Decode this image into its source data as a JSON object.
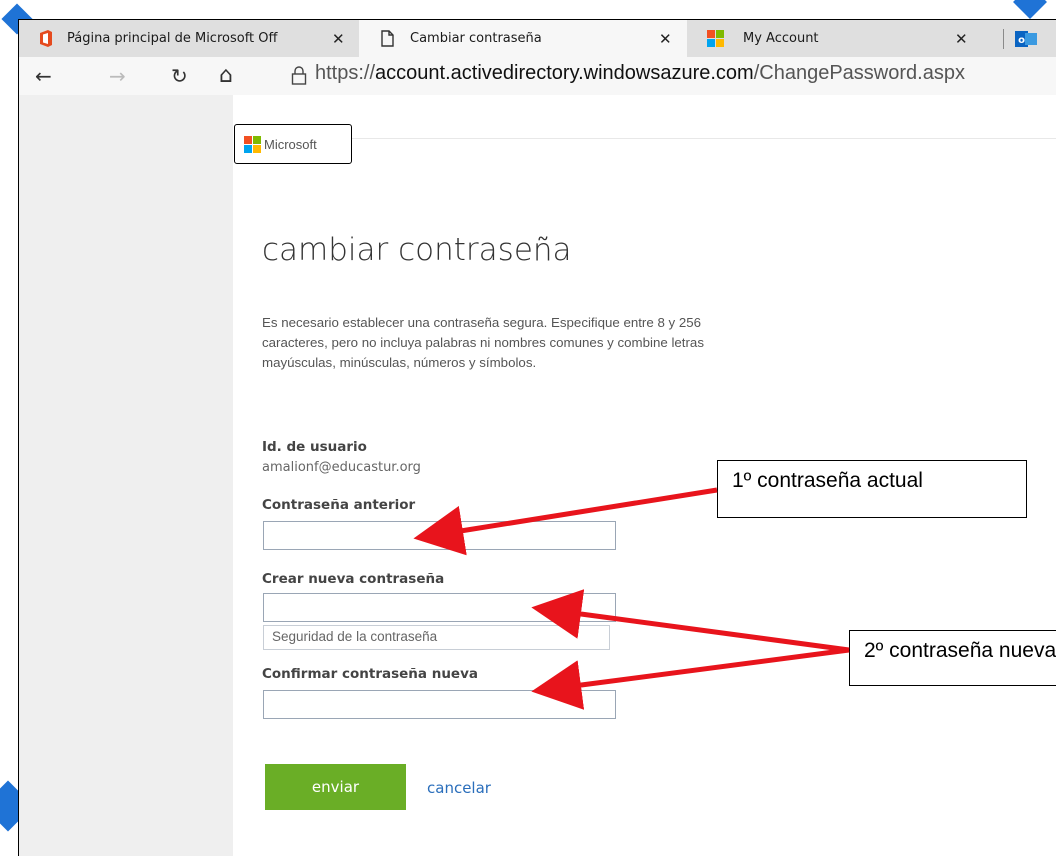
{
  "tabs": [
    {
      "label": "Página principal de Microsoft Off",
      "icon": "office-icon",
      "close": "✕"
    },
    {
      "label": "Cambiar contraseña",
      "icon": "page-icon",
      "close": "✕"
    },
    {
      "label": "My Account",
      "icon": "microsoft-logo-icon",
      "close": "✕"
    }
  ],
  "toolbar": {
    "back": "←",
    "forward": "→",
    "refresh": "↻",
    "home": "⌂",
    "lock": "🔒",
    "url_prefix": "https://",
    "url_domain": "account.activedirectory.windowsazure.com",
    "url_path": "/ChangePassword.aspx"
  },
  "header": {
    "logo_text": "Microsoft"
  },
  "form": {
    "title": "cambiar contraseña",
    "description": "Es necesario establecer una contraseña segura. Especifique entre 8 y 256 caracteres, pero no incluya palabras ni nombres comunes y combine letras mayúsculas, minúsculas, números y símbolos.",
    "user_id_label": "Id. de usuario",
    "user_id_value": "amalionf@educastur.org",
    "old_password_label": "Contraseña anterior",
    "old_password_value": "",
    "new_password_label": "Crear nueva contraseña",
    "new_password_value": "",
    "strength_label": "Seguridad de la contraseña",
    "confirm_label": "Confirmar contraseña nueva",
    "confirm_value": "",
    "submit_label": "enviar",
    "cancel_label": "cancelar"
  },
  "annotations": {
    "note1": "1º contraseña actual",
    "note2": "2º contraseña nueva"
  },
  "colors": {
    "submit_button": "#6aae26",
    "cancel_link": "#2a6ebb",
    "arrow": "#e8141c",
    "page_side": "#efefef"
  }
}
